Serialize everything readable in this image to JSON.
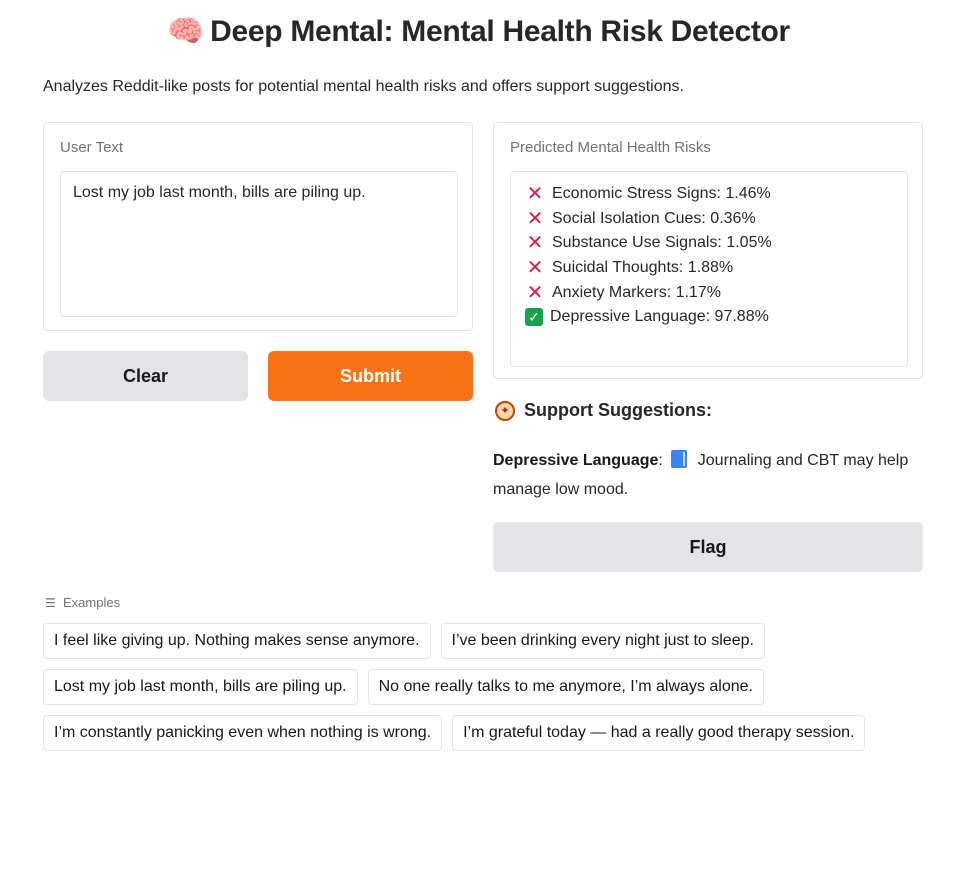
{
  "header": {
    "emoji": "🧠",
    "title": "Deep Mental: Mental Health Risk Detector",
    "description": "Analyzes Reddit-like posts for potential mental health risks and offers support suggestions."
  },
  "input": {
    "label": "User Text",
    "value": "Lost my job last month, bills are piling up."
  },
  "buttons": {
    "clear": "Clear",
    "submit": "Submit",
    "flag": "Flag"
  },
  "output": {
    "label": "Predicted Mental Health Risks",
    "risks": [
      {
        "status": "x",
        "text": "Economic Stress Signs: 1.46%"
      },
      {
        "status": "x",
        "text": "Social Isolation Cues: 0.36%"
      },
      {
        "status": "x",
        "text": "Substance Use Signals: 1.05%"
      },
      {
        "status": "x",
        "text": "Suicidal Thoughts: 1.88%"
      },
      {
        "status": "x",
        "text": "Anxiety Markers: 1.17%"
      },
      {
        "status": "check",
        "text": "Depressive Language: 97.88%"
      }
    ]
  },
  "support": {
    "heading": "Support Suggestions:",
    "category": "Depressive Language",
    "separator": ":",
    "text": "Journaling and CBT may help manage low mood."
  },
  "examples": {
    "label": "Examples",
    "items": [
      "I feel like giving up. Nothing makes sense anymore.",
      "I’ve been drinking every night just to sleep.",
      "Lost my job last month, bills are piling up.",
      "No one really talks to me anymore, I’m always alone.",
      "I’m constantly panicking even when nothing is wrong.",
      "I’m grateful today — had a really good therapy session."
    ]
  },
  "colors": {
    "submit": "#f97316",
    "secondary_button": "#e4e4e7",
    "risk_x": "#e11d48",
    "risk_check": "#16a34a"
  }
}
